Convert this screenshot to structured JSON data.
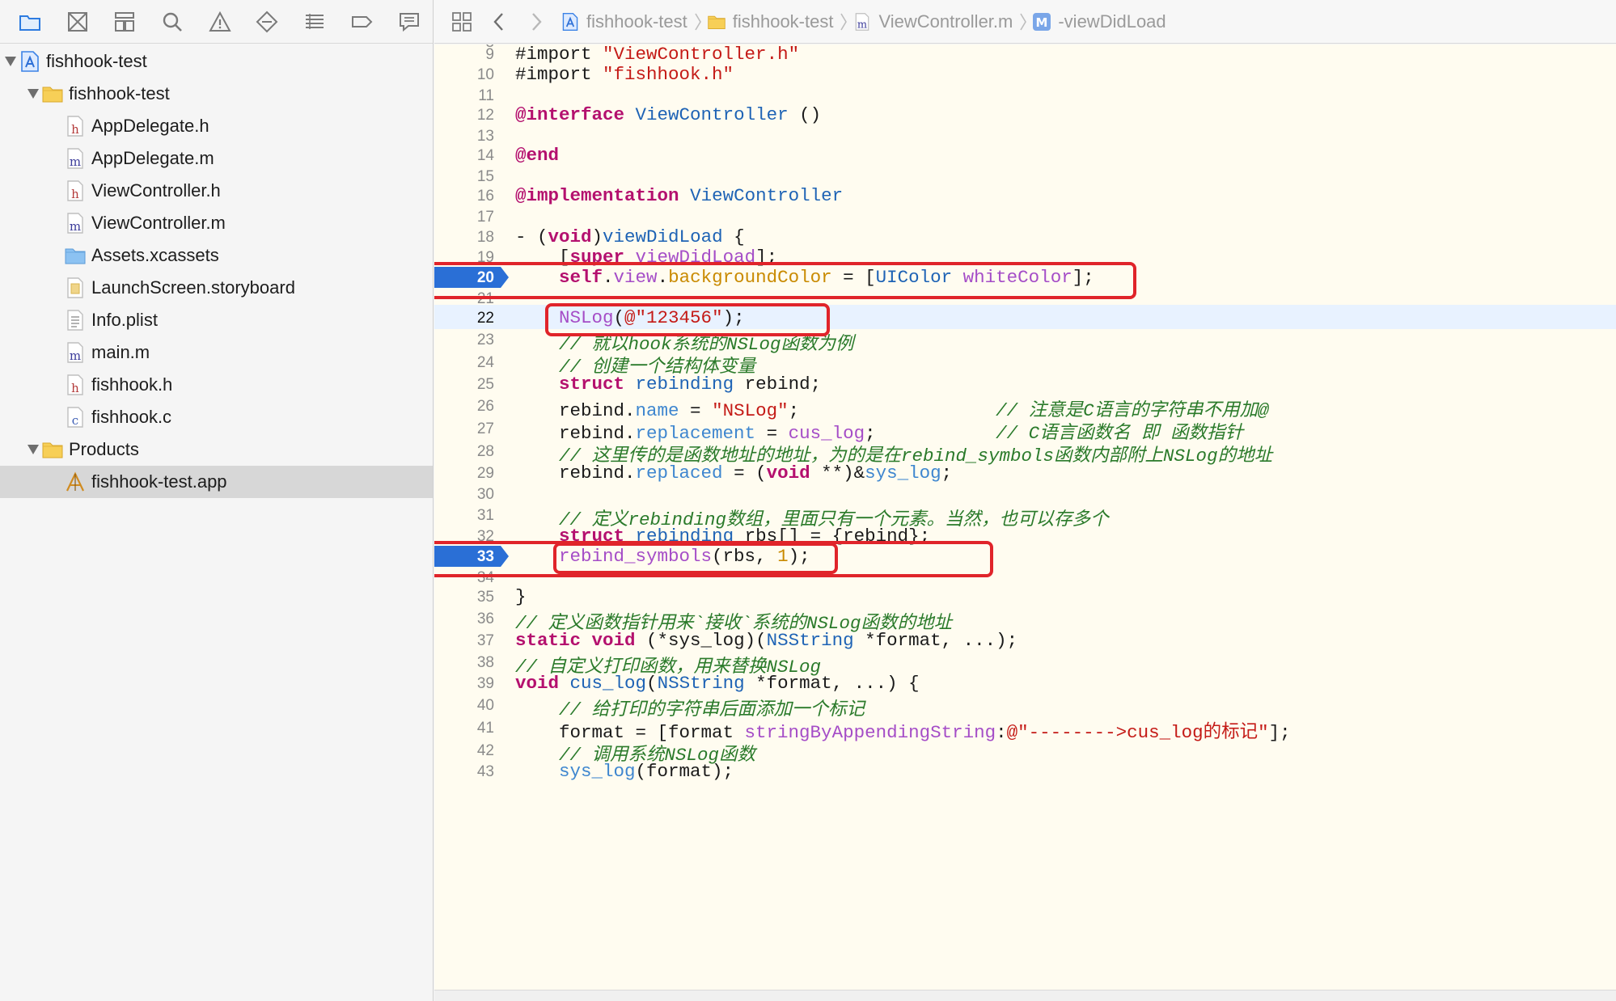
{
  "navigator": {
    "toolbar_icons": [
      "folder-icon",
      "source-control-icon",
      "symbol-icon",
      "search-icon",
      "warning-icon",
      "test-icon",
      "debug-icon",
      "breakpoint-icon",
      "report-icon"
    ],
    "tree": [
      {
        "label": "fishhook-test",
        "depth": 0,
        "expanded": true,
        "icon": "project-icon",
        "name": "project-fishhook-test"
      },
      {
        "label": "fishhook-test",
        "depth": 1,
        "expanded": true,
        "icon": "group-folder-icon",
        "name": "group-fishhook-test"
      },
      {
        "label": "AppDelegate.h",
        "depth": 2,
        "icon": "header-file-icon",
        "badge": "h",
        "name": "file-appdelegate-h"
      },
      {
        "label": "AppDelegate.m",
        "depth": 2,
        "icon": "objc-file-icon",
        "badge": "m",
        "name": "file-appdelegate-m"
      },
      {
        "label": "ViewController.h",
        "depth": 2,
        "icon": "header-file-icon",
        "badge": "h",
        "name": "file-viewcontroller-h"
      },
      {
        "label": "ViewController.m",
        "depth": 2,
        "icon": "objc-file-icon",
        "badge": "m",
        "name": "file-viewcontroller-m"
      },
      {
        "label": "Assets.xcassets",
        "depth": 2,
        "icon": "assets-folder-icon",
        "name": "file-assets"
      },
      {
        "label": "LaunchScreen.storyboard",
        "depth": 2,
        "icon": "storyboard-file-icon",
        "name": "file-launchscreen"
      },
      {
        "label": "Info.plist",
        "depth": 2,
        "icon": "plist-file-icon",
        "name": "file-info-plist"
      },
      {
        "label": "main.m",
        "depth": 2,
        "icon": "objc-file-icon",
        "badge": "m",
        "name": "file-main-m"
      },
      {
        "label": "fishhook.h",
        "depth": 2,
        "icon": "header-file-icon",
        "badge": "h",
        "name": "file-fishhook-h"
      },
      {
        "label": "fishhook.c",
        "depth": 2,
        "icon": "c-file-icon",
        "badge": "c",
        "name": "file-fishhook-c"
      },
      {
        "label": "Products",
        "depth": 1,
        "expanded": true,
        "icon": "group-folder-icon",
        "name": "group-products"
      },
      {
        "label": "fishhook-test.app",
        "depth": 2,
        "icon": "app-product-icon",
        "selected": true,
        "name": "file-fishhook-test-app"
      }
    ]
  },
  "jumpbar": {
    "crumbs": [
      {
        "label": "fishhook-test",
        "icon": "project-icon"
      },
      {
        "label": "fishhook-test",
        "icon": "group-folder-icon"
      },
      {
        "label": "ViewController.m",
        "icon": "objc-file-icon"
      },
      {
        "label": "-viewDidLoad",
        "icon": "method-icon",
        "badge": "M"
      }
    ]
  },
  "editor": {
    "current_line": 22,
    "breakpoints": [
      20,
      33
    ],
    "lines": [
      {
        "n": "8",
        "t": [
          [
            "plain",
            ""
          ]
        ],
        "partial": "top"
      },
      {
        "n": "9",
        "t": [
          [
            "plain",
            "#import "
          ],
          [
            "str",
            "\"ViewController.h\""
          ]
        ]
      },
      {
        "n": "10",
        "t": [
          [
            "plain",
            "#import "
          ],
          [
            "str",
            "\"fishhook.h\""
          ]
        ]
      },
      {
        "n": "11",
        "t": []
      },
      {
        "n": "12",
        "t": [
          [
            "kw",
            "@interface"
          ],
          [
            "plain",
            " "
          ],
          [
            "cls",
            "ViewController"
          ],
          [
            "plain",
            " ()"
          ]
        ]
      },
      {
        "n": "13",
        "t": []
      },
      {
        "n": "14",
        "t": [
          [
            "kw",
            "@end"
          ]
        ]
      },
      {
        "n": "15",
        "t": []
      },
      {
        "n": "16",
        "t": [
          [
            "kw",
            "@implementation"
          ],
          [
            "plain",
            " "
          ],
          [
            "cls",
            "ViewController"
          ]
        ]
      },
      {
        "n": "17",
        "t": []
      },
      {
        "n": "18",
        "t": [
          [
            "plain",
            "- ("
          ],
          [
            "kw",
            "void"
          ],
          [
            "plain",
            ")"
          ],
          [
            "cls",
            "viewDidLoad"
          ],
          [
            "plain",
            " {"
          ]
        ]
      },
      {
        "n": "19",
        "t": [
          [
            "plain",
            "    ["
          ],
          [
            "kw",
            "super"
          ],
          [
            "plain",
            " "
          ],
          [
            "meth",
            "viewDidLoad"
          ],
          [
            "plain",
            "];"
          ]
        ]
      },
      {
        "n": "20",
        "t": [
          [
            "plain",
            "    "
          ],
          [
            "kw",
            "self"
          ],
          [
            "plain",
            "."
          ],
          [
            "meth",
            "view"
          ],
          [
            "plain",
            "."
          ],
          [
            "num",
            "backgroundColor"
          ],
          [
            "plain",
            " = ["
          ],
          [
            "cls",
            "UIColor"
          ],
          [
            "plain",
            " "
          ],
          [
            "meth",
            "whiteColor"
          ],
          [
            "plain",
            "];"
          ]
        ]
      },
      {
        "n": "21",
        "t": [],
        "partial": "mid"
      },
      {
        "n": "22",
        "t": [
          [
            "plain",
            "    "
          ],
          [
            "meth",
            "NSLog"
          ],
          [
            "plain",
            "("
          ],
          [
            "str",
            "@\"123456\""
          ],
          [
            "plain",
            ");"
          ]
        ]
      },
      {
        "n": "23",
        "t": [
          [
            "plain",
            "    "
          ],
          [
            "cmt",
            "// 就以hook系统的NSLog函数为例"
          ]
        ]
      },
      {
        "n": "24",
        "t": [
          [
            "plain",
            "    "
          ],
          [
            "cmt",
            "// 创建一个结构体变量"
          ]
        ]
      },
      {
        "n": "25",
        "t": [
          [
            "plain",
            "    "
          ],
          [
            "kw",
            "struct"
          ],
          [
            "plain",
            " "
          ],
          [
            "cls",
            "rebinding"
          ],
          [
            "plain",
            " rebind;"
          ]
        ]
      },
      {
        "n": "26",
        "t": [
          [
            "plain",
            "    rebind."
          ],
          [
            "prop",
            "name"
          ],
          [
            "plain",
            " = "
          ],
          [
            "str",
            "\"NSLog\""
          ],
          [
            "plain",
            ";                  "
          ],
          [
            "cmt",
            "// 注意是C语言的字符串不用加@"
          ]
        ]
      },
      {
        "n": "27",
        "t": [
          [
            "plain",
            "    rebind."
          ],
          [
            "prop",
            "replacement"
          ],
          [
            "plain",
            " = "
          ],
          [
            "meth",
            "cus_log"
          ],
          [
            "plain",
            ";           "
          ],
          [
            "cmt",
            "// C语言函数名 即 函数指针"
          ]
        ]
      },
      {
        "n": "28",
        "t": [
          [
            "plain",
            "    "
          ],
          [
            "cmt",
            "// 这里传的是函数地址的地址，为的是在rebind_symbols函数内部附上NSLog的地址"
          ]
        ]
      },
      {
        "n": "29",
        "t": [
          [
            "plain",
            "    rebind."
          ],
          [
            "prop",
            "replaced"
          ],
          [
            "plain",
            " = ("
          ],
          [
            "kw",
            "void"
          ],
          [
            "plain",
            " **)&"
          ],
          [
            "prop",
            "sys_log"
          ],
          [
            "plain",
            ";"
          ]
        ]
      },
      {
        "n": "30",
        "t": []
      },
      {
        "n": "31",
        "t": [
          [
            "plain",
            "    "
          ],
          [
            "cmt",
            "// 定义rebinding数组，里面只有一个元素。当然，也可以存多个"
          ]
        ]
      },
      {
        "n": "32",
        "t": [
          [
            "plain",
            "    "
          ],
          [
            "kw",
            "struct"
          ],
          [
            "plain",
            " "
          ],
          [
            "cls",
            "rebinding"
          ],
          [
            "plain",
            " rbs[] = {rebind};"
          ]
        ]
      },
      {
        "n": "33",
        "t": [
          [
            "plain",
            "    "
          ],
          [
            "meth",
            "rebind_symbols"
          ],
          [
            "plain",
            "(rbs, "
          ],
          [
            "num",
            "1"
          ],
          [
            "plain",
            ");"
          ]
        ]
      },
      {
        "n": "34",
        "t": [],
        "partial": "mid"
      },
      {
        "n": "35",
        "t": [
          [
            "plain",
            "}"
          ]
        ]
      },
      {
        "n": "36",
        "t": [
          [
            "cmt",
            "// 定义函数指针用来`接收`系统的NSLog函数的地址"
          ]
        ]
      },
      {
        "n": "37",
        "t": [
          [
            "kw",
            "static"
          ],
          [
            "plain",
            " "
          ],
          [
            "kw",
            "void"
          ],
          [
            "plain",
            " (*sys_log)("
          ],
          [
            "cls",
            "NSString"
          ],
          [
            "plain",
            " *format, ...);"
          ]
        ]
      },
      {
        "n": "38",
        "t": [
          [
            "cmt",
            "// 自定义打印函数，用来替换NSLog"
          ]
        ]
      },
      {
        "n": "39",
        "t": [
          [
            "kw",
            "void"
          ],
          [
            "plain",
            " "
          ],
          [
            "cls",
            "cus_log"
          ],
          [
            "plain",
            "("
          ],
          [
            "cls",
            "NSString"
          ],
          [
            "plain",
            " *format, ...) {"
          ]
        ]
      },
      {
        "n": "40",
        "t": [
          [
            "plain",
            "    "
          ],
          [
            "cmt",
            "// 给打印的字符串后面添加一个标记"
          ]
        ]
      },
      {
        "n": "41",
        "t": [
          [
            "plain",
            "    format = [format "
          ],
          [
            "meth",
            "stringByAppendingString"
          ],
          [
            "plain",
            ":"
          ],
          [
            "str",
            "@\"-------->cus_log的标记\""
          ],
          [
            "plain",
            "];"
          ]
        ]
      },
      {
        "n": "42",
        "t": [
          [
            "plain",
            "    "
          ],
          [
            "cmt",
            "// 调用系统NSLog函数"
          ]
        ]
      },
      {
        "n": "43",
        "t": [
          [
            "plain",
            "    "
          ],
          [
            "prop",
            "sys_log"
          ],
          [
            "plain",
            "(format);"
          ]
        ],
        "partial": "bottom"
      }
    ]
  },
  "colors": {
    "breakpoint": "#2a6fd6",
    "annotation_box": "#e0242a",
    "editor_bg": "#fffcf0",
    "current_line_bg": "#e8f2ff"
  }
}
